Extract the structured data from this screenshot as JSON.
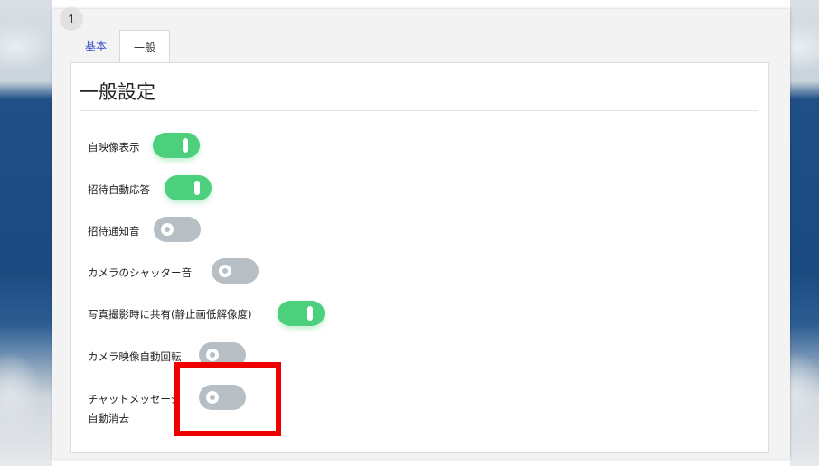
{
  "step": {
    "number": "1"
  },
  "tabs": [
    {
      "label": "基本",
      "active": false
    },
    {
      "label": "一般",
      "active": true
    }
  ],
  "section": {
    "title": "一般設定"
  },
  "settings": [
    {
      "label": "自映像表示",
      "state": "on"
    },
    {
      "label": "招待自動応答",
      "state": "on"
    },
    {
      "label": "招待通知音",
      "state": "off"
    },
    {
      "label": "カメラのシャッター音",
      "state": "off"
    },
    {
      "label": "写真撮影時に共有(静止画低解像度)",
      "state": "on"
    },
    {
      "label": "カメラ映像自動回転",
      "state": "off"
    },
    {
      "label_line1": "チャットメッセージ",
      "label_line2": "自動消去",
      "state": "off"
    }
  ],
  "colors": {
    "toggle_on": "#4cd07d",
    "toggle_off": "#b7bfc5",
    "tab_link": "#3a4ec8",
    "highlight": "#ee0000"
  }
}
